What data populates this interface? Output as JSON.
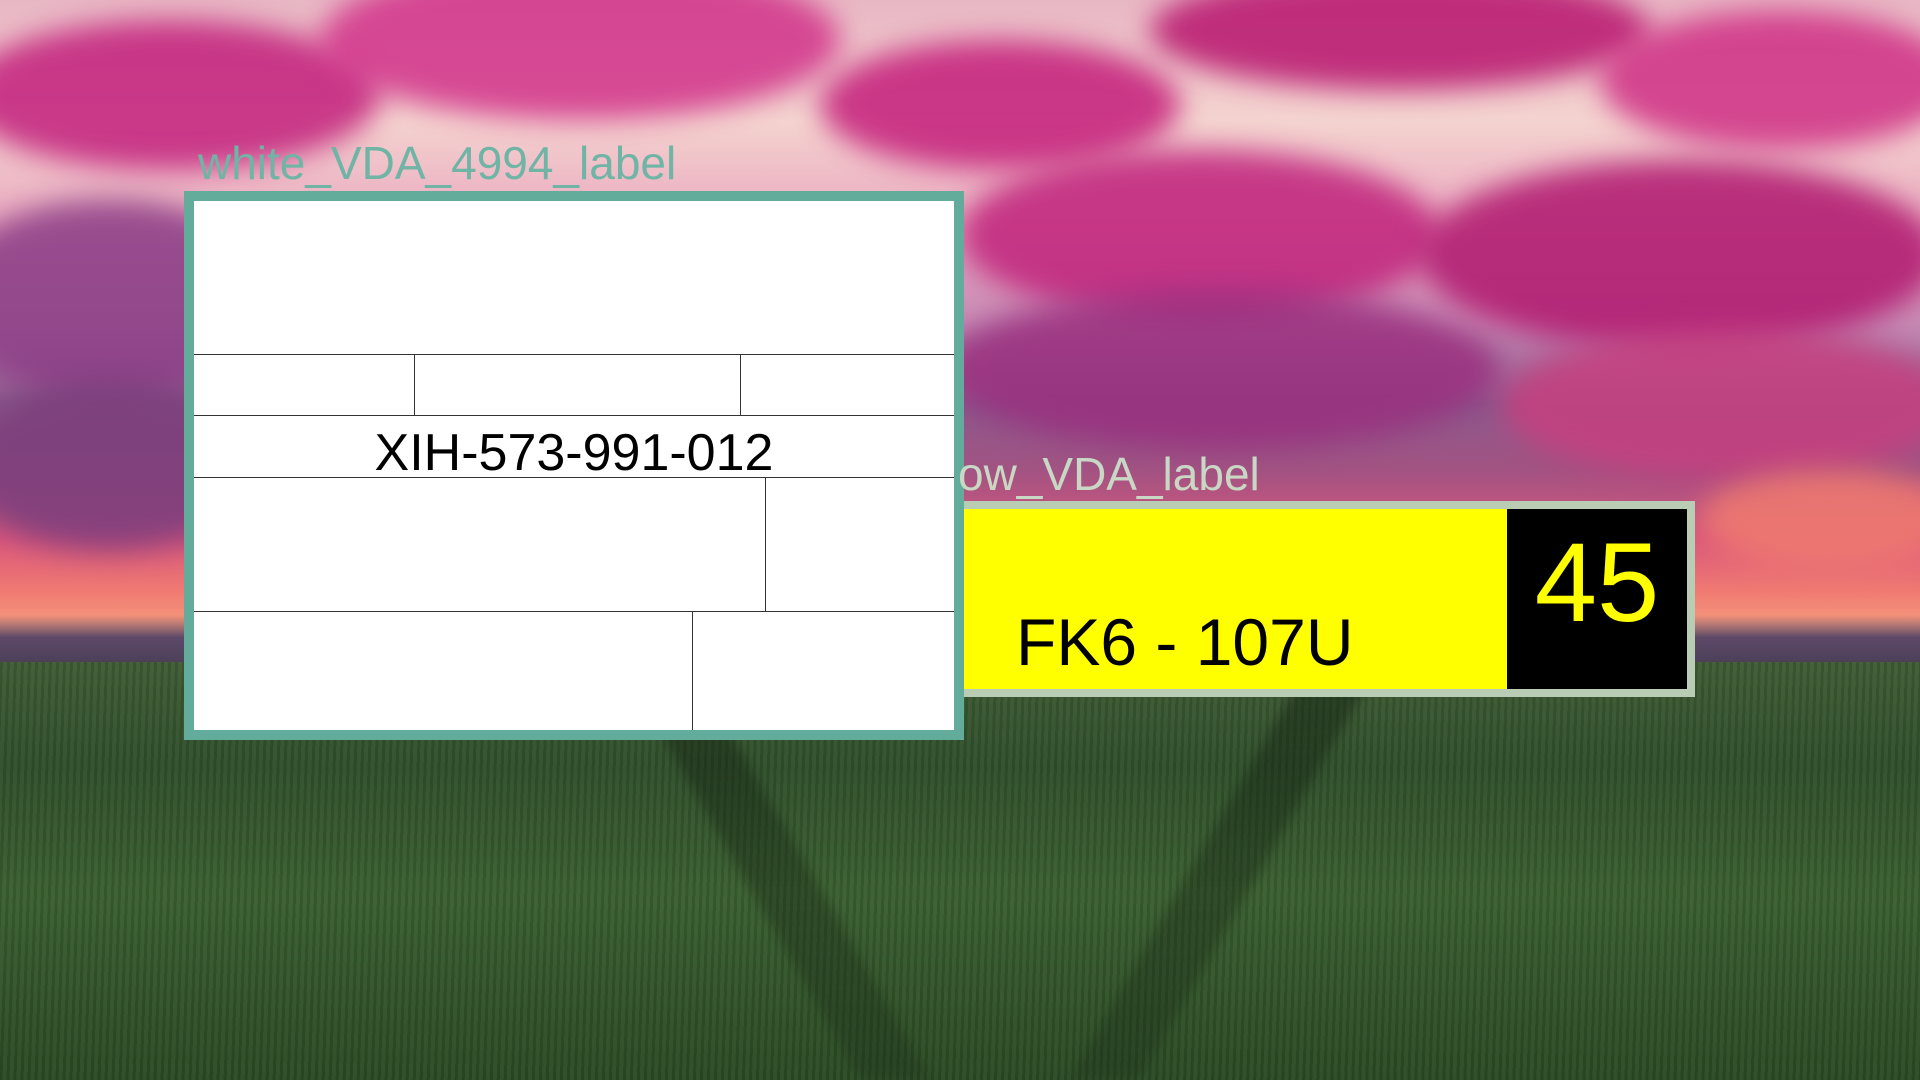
{
  "white_label": {
    "caption": "white_VDA_4994_label",
    "code": "XIH-573-991-012",
    "border_color": "#63ab9b"
  },
  "yellow_label": {
    "caption": "ow_VDA_label",
    "code": "FK6 - 107U",
    "number": "45",
    "fill_color": "#ffff00",
    "number_background": "#000000"
  }
}
